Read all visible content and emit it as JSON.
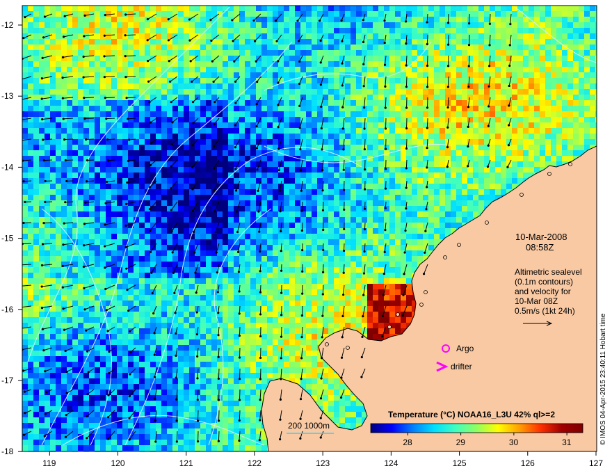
{
  "map": {
    "lon_range": [
      118.6,
      127
    ],
    "lat_range": [
      -18,
      -11.75
    ],
    "lon_ticks": [
      "119",
      "120",
      "121",
      "122",
      "123",
      "124",
      "125",
      "126",
      "127"
    ],
    "lat_ticks": [
      "-12",
      "-13",
      "-14",
      "-15",
      "-16",
      "-17",
      "-18"
    ],
    "land_color": "#f9c9a3",
    "coast_color": "#000000",
    "contour_color": "#d8f0ff",
    "arrow_color": "#000000"
  },
  "overlay": {
    "date": "10-Mar-2008",
    "time": "08:58Z",
    "alt_line1": "Altimetric sealevel",
    "alt_line2": "(0.1m contours)",
    "alt_line3": "and velocity for",
    "alt_line4": "10-Mar 08Z",
    "alt_line5": "0.5m/s (1kt 24h)",
    "argo_label": "Argo",
    "drifter_label": "drifter",
    "depth_label": "200  1000m",
    "credit": "© IMOS 04-Apr-2015 23:40:11 Hobart time"
  },
  "colorbar": {
    "title": "Temperature (°C) NOAA16_L3U 42% ql>=2",
    "range": [
      27.3,
      31.3
    ],
    "ticks": [
      "28",
      "29",
      "30",
      "31"
    ],
    "colors": [
      "#00007f",
      "#0000ff",
      "#0080ff",
      "#00e0ff",
      "#40ffbf",
      "#90ff60",
      "#ffff00",
      "#ffa000",
      "#ff3000",
      "#a00000",
      "#7f0000"
    ]
  }
}
